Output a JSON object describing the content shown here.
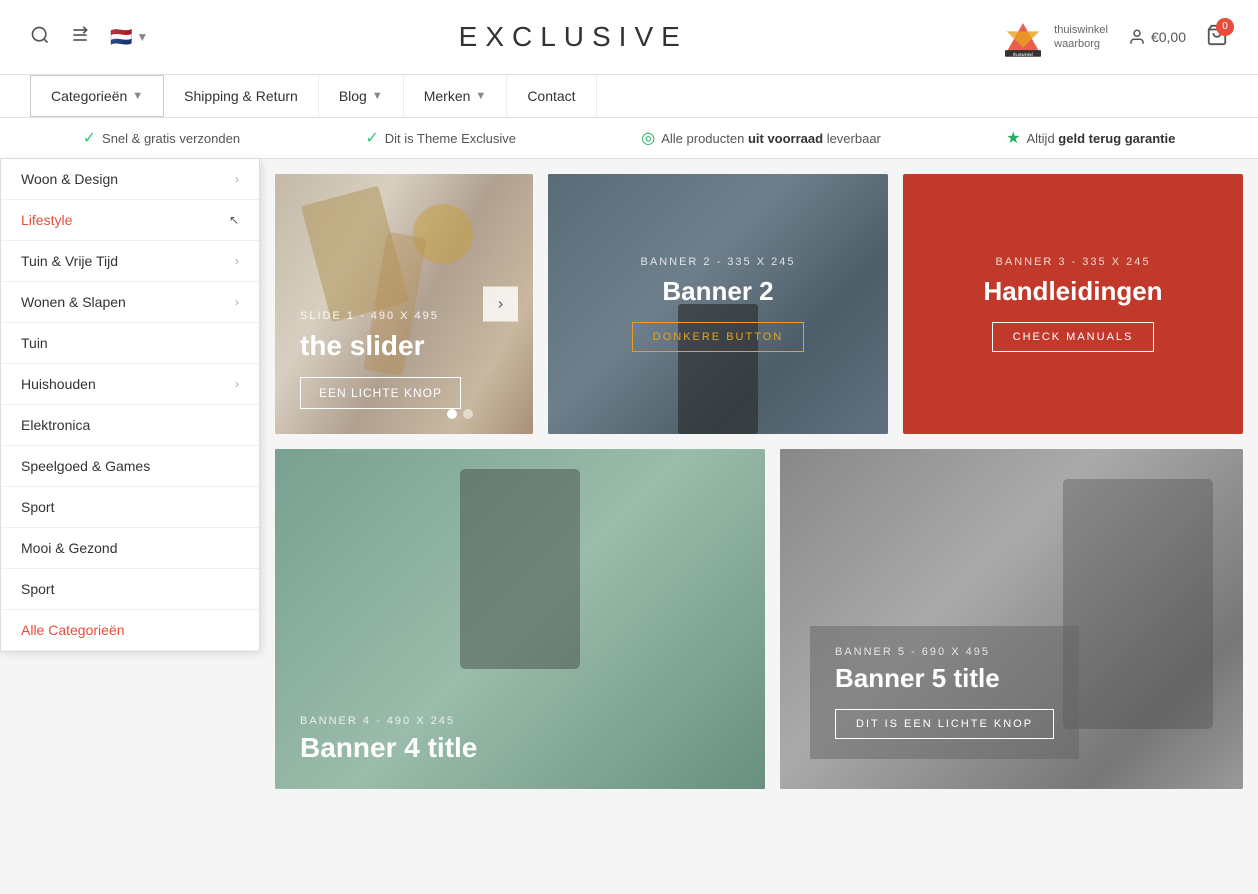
{
  "header": {
    "logo": "EXCLUSIVE",
    "account_text": "€0,00",
    "cart_count": "0",
    "thuiswinkel_text": "thuiswinkel\nwaarborg"
  },
  "navbar": {
    "items": [
      {
        "label": "Categorieën",
        "hasChevron": true,
        "id": "categories"
      },
      {
        "label": "Shipping & Return",
        "hasChevron": false,
        "id": "shipping"
      },
      {
        "label": "Blog",
        "hasChevron": true,
        "id": "blog"
      },
      {
        "label": "Merken",
        "hasChevron": true,
        "id": "merken"
      },
      {
        "label": "Contact",
        "hasChevron": false,
        "id": "contact"
      }
    ]
  },
  "infobar": {
    "items": [
      {
        "icon": "✓",
        "icon_type": "check",
        "text": "Snel & gratis verzonden"
      },
      {
        "icon": "✓",
        "icon_type": "check",
        "text": "Dit is Theme Exclusive"
      },
      {
        "icon": "◎",
        "icon_type": "circle",
        "text_pre": "Alle producten ",
        "text_bold": "uit voorraad",
        "text_post": " leverbaar"
      },
      {
        "icon": "★",
        "icon_type": "star",
        "text_pre": "Altijd ",
        "text_bold": "geld terug garantie",
        "text_post": ""
      }
    ]
  },
  "dropdown": {
    "items": [
      {
        "label": "Woon & Design",
        "hasArrow": true,
        "id": "woon-design"
      },
      {
        "label": "Lifestyle",
        "hasArrow": false,
        "id": "lifestyle",
        "highlighted": true
      },
      {
        "label": "Tuin & Vrije Tijd",
        "hasArrow": true,
        "id": "tuin-vrije-tijd"
      },
      {
        "label": "Wonen & Slapen",
        "hasArrow": true,
        "id": "wonen-slapen"
      },
      {
        "label": "Tuin",
        "hasArrow": false,
        "id": "tuin"
      },
      {
        "label": "Huishouden",
        "hasArrow": true,
        "id": "huishouden"
      },
      {
        "label": "Elektronica",
        "hasArrow": false,
        "id": "elektronica"
      },
      {
        "label": "Speelgoed & Games",
        "hasArrow": false,
        "id": "speelgoed"
      },
      {
        "label": "Sport",
        "hasArrow": false,
        "id": "sport-1"
      },
      {
        "label": "Mooi & Gezond",
        "hasArrow": false,
        "id": "mooi-gezond"
      },
      {
        "label": "Sport",
        "hasArrow": false,
        "id": "sport-2"
      },
      {
        "label": "Alle Categorieën",
        "hasArrow": false,
        "id": "alle-cat",
        "red": true
      }
    ]
  },
  "slider": {
    "subtitle": "SLIDE 1 - 490 X 495",
    "title": "the slider",
    "btn_label": "EEN LICHTE KNOP",
    "nav_icon": "›",
    "dots": [
      true,
      false
    ]
  },
  "banner2": {
    "subtitle": "BANNER 2 - 335 X 245",
    "title": "Banner 2",
    "btn_label": "DONKERE BUTTON"
  },
  "banner3": {
    "subtitle": "BANNER 3 - 335 X 245",
    "title": "Handleidingen",
    "btn_label": "CHECK MANUALS"
  },
  "banner4": {
    "subtitle": "BANNER 4 - 490 X 245",
    "title": "Banner 4 title"
  },
  "banner5": {
    "subtitle": "BANNER 5 - 690 X 495",
    "title": "Banner 5 title",
    "btn_label": "DIT IS EEN LICHTE KNOP"
  }
}
